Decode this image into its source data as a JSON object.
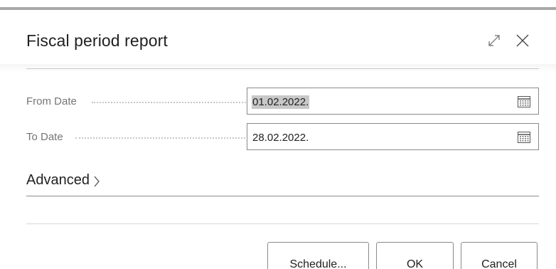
{
  "dialog": {
    "title": "Fiscal period report",
    "expand_icon": "expand-icon",
    "close_icon": "close-icon"
  },
  "fields": {
    "from_date": {
      "label": "From Date",
      "value": "01.02.2022.",
      "icon": "calendar-icon"
    },
    "to_date": {
      "label": "To Date",
      "value": "28.02.2022.",
      "icon": "calendar-icon"
    }
  },
  "advanced": {
    "label": "Advanced",
    "icon": "chevron-right-icon"
  },
  "buttons": {
    "schedule": "Schedule...",
    "ok": "OK",
    "cancel": "Cancel"
  },
  "colors": {
    "selection": "#c8c8c8",
    "label": "#757575",
    "border": "#8a8a8a"
  }
}
